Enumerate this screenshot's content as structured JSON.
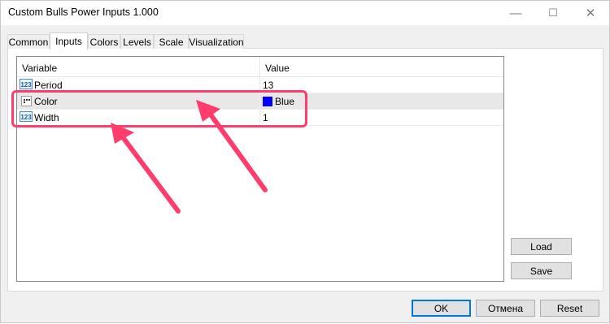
{
  "window": {
    "title": "Custom Bulls Power Inputs 1.000"
  },
  "titlebar_buttons": {
    "minimize": "—",
    "maximize": "☐",
    "close": "✕"
  },
  "tabs": [
    {
      "label": "Common"
    },
    {
      "label": "Inputs"
    },
    {
      "label": "Colors"
    },
    {
      "label": "Levels"
    },
    {
      "label": "Scale"
    },
    {
      "label": "Visualization"
    }
  ],
  "active_tab": "Inputs",
  "grid": {
    "columns": [
      {
        "label": "Variable"
      },
      {
        "label": "Value"
      }
    ],
    "rows": [
      {
        "name": "Period",
        "value": "13",
        "icon": "numeric-123-icon"
      },
      {
        "name": "Color",
        "value": "Blue",
        "icon": "enum-list-icon",
        "swatch_color": "#0000ff",
        "selected": true
      },
      {
        "name": "Width",
        "value": "1",
        "icon": "numeric-123-icon"
      }
    ]
  },
  "side_buttons": {
    "load": "Load",
    "save": "Save"
  },
  "footer_buttons": {
    "ok": "OK",
    "cancel": "Отмена",
    "reset": "Reset"
  },
  "annotation_color": "#ff3d6c"
}
